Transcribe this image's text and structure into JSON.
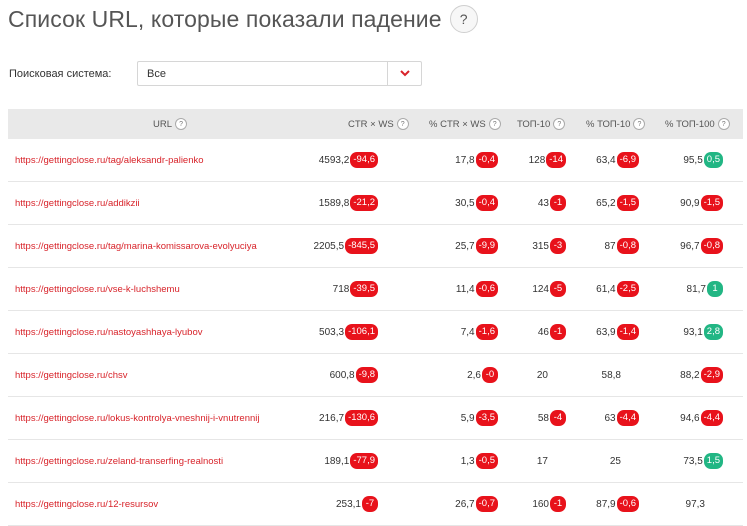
{
  "page": {
    "title": "Список URL, которые показали падение",
    "help": "?"
  },
  "filter": {
    "label": "Поисковая система:",
    "value": "Все"
  },
  "colors": {
    "negative": "#e8121b",
    "positive": "#22b684",
    "link": "#d8232a",
    "header_bg": "#e9e9e9"
  },
  "table": {
    "headers": {
      "url": "URL",
      "ctr_ws": "CTR × WS",
      "pct_ctr_ws": "% CTR × WS",
      "top10": "ТОП-10",
      "pct_top10": "% ТОП-10",
      "pct_top100": "% ТОП-100"
    },
    "rows": [
      {
        "url": "https://gettingclose.ru/tag/aleksandr-palienko",
        "ctr_ws": "4593,2",
        "ctr_ws_delta": "-94,6",
        "pct_ctr_ws": "17,8",
        "pct_ctr_ws_delta": "-0,4",
        "top10": "128",
        "top10_delta": "-14",
        "pct_top10": "63,4",
        "pct_top10_delta": "-6,9",
        "pct_top100": "95,5",
        "pct_top100_delta": "0,5"
      },
      {
        "url": "https://gettingclose.ru/addikzii",
        "ctr_ws": "1589,8",
        "ctr_ws_delta": "-21,2",
        "pct_ctr_ws": "30,5",
        "pct_ctr_ws_delta": "-0,4",
        "top10": "43",
        "top10_delta": "-1",
        "pct_top10": "65,2",
        "pct_top10_delta": "-1,5",
        "pct_top100": "90,9",
        "pct_top100_delta": "-1,5"
      },
      {
        "url": "https://gettingclose.ru/tag/marina-komissarova-evolyuciya",
        "ctr_ws": "2205,5",
        "ctr_ws_delta": "-845,5",
        "pct_ctr_ws": "25,7",
        "pct_ctr_ws_delta": "-9,9",
        "top10": "315",
        "top10_delta": "-3",
        "pct_top10": "87",
        "pct_top10_delta": "-0,8",
        "pct_top100": "96,7",
        "pct_top100_delta": "-0,8"
      },
      {
        "url": "https://gettingclose.ru/vse-k-luchshemu",
        "ctr_ws": "718",
        "ctr_ws_delta": "-39,5",
        "pct_ctr_ws": "11,4",
        "pct_ctr_ws_delta": "-0,6",
        "top10": "124",
        "top10_delta": "-5",
        "pct_top10": "61,4",
        "pct_top10_delta": "-2,5",
        "pct_top100": "81,7",
        "pct_top100_delta": "1"
      },
      {
        "url": "https://gettingclose.ru/nastoyashhaya-lyubov",
        "ctr_ws": "503,3",
        "ctr_ws_delta": "-106,1",
        "pct_ctr_ws": "7,4",
        "pct_ctr_ws_delta": "-1,6",
        "top10": "46",
        "top10_delta": "-1",
        "pct_top10": "63,9",
        "pct_top10_delta": "-1,4",
        "pct_top100": "93,1",
        "pct_top100_delta": "2,8"
      },
      {
        "url": "https://gettingclose.ru/chsv",
        "ctr_ws": "600,8",
        "ctr_ws_delta": "-9,8",
        "pct_ctr_ws": "2,6",
        "pct_ctr_ws_delta": "-0",
        "top10": "20",
        "top10_delta": "",
        "pct_top10": "58,8",
        "pct_top10_delta": "",
        "pct_top100": "88,2",
        "pct_top100_delta": "-2,9"
      },
      {
        "url": "https://gettingclose.ru/lokus-kontrolya-vneshnij-i-vnutrennij",
        "ctr_ws": "216,7",
        "ctr_ws_delta": "-130,6",
        "pct_ctr_ws": "5,9",
        "pct_ctr_ws_delta": "-3,5",
        "top10": "58",
        "top10_delta": "-4",
        "pct_top10": "63",
        "pct_top10_delta": "-4,4",
        "pct_top100": "94,6",
        "pct_top100_delta": "-4,4"
      },
      {
        "url": "https://gettingclose.ru/zeland-transerfing-realnosti",
        "ctr_ws": "189,1",
        "ctr_ws_delta": "-77,9",
        "pct_ctr_ws": "1,3",
        "pct_ctr_ws_delta": "-0,5",
        "top10": "17",
        "top10_delta": "",
        "pct_top10": "25",
        "pct_top10_delta": "",
        "pct_top100": "73,5",
        "pct_top100_delta": "1,5"
      },
      {
        "url": "https://gettingclose.ru/12-resursov",
        "ctr_ws": "253,1",
        "ctr_ws_delta": "-7",
        "pct_ctr_ws": "26,7",
        "pct_ctr_ws_delta": "-0,7",
        "top10": "160",
        "top10_delta": "-1",
        "pct_top10": "87,9",
        "pct_top10_delta": "-0,6",
        "pct_top100": "97,3",
        "pct_top100_delta": ""
      }
    ]
  }
}
